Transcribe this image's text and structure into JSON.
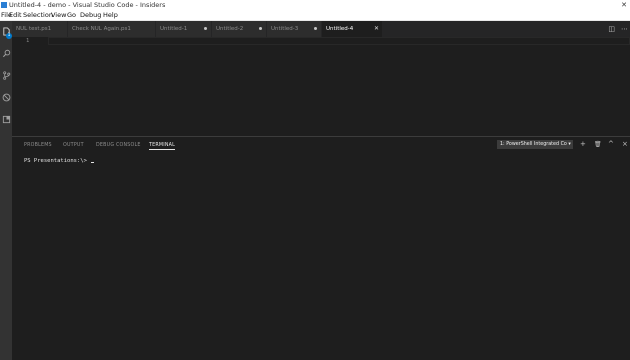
{
  "window": {
    "title": "Untitled-4 - demo - Visual Studio Code - Insiders"
  },
  "menubar": {
    "items": [
      "File",
      "Edit",
      "Selection",
      "View",
      "Go",
      "Debug",
      "Help"
    ]
  },
  "activitybar": {
    "icons": [
      "files-icon",
      "search-icon",
      "source-control-icon",
      "debug-icon",
      "extensions-icon"
    ],
    "badge": "1"
  },
  "tabs": [
    {
      "label": "NUL test.ps1",
      "dirty": false
    },
    {
      "label": "Check NUL Again.ps1",
      "dirty": false
    },
    {
      "label": "Untitled-1",
      "dirty": true
    },
    {
      "label": "Untitled-2",
      "dirty": true
    },
    {
      "label": "Untitled-3",
      "dirty": true
    },
    {
      "label": "Untitled-4",
      "active": true
    }
  ],
  "editor": {
    "line_number": "1"
  },
  "panel": {
    "tabs": [
      "PROBLEMS",
      "OUTPUT",
      "DEBUG CONSOLE",
      "TERMINAL"
    ],
    "active_tab": "TERMINAL",
    "terminal_selector": "1: PowerShell Integrated Co ▾",
    "actions": [
      "+",
      "🗑",
      "^",
      "×"
    ]
  },
  "terminal": {
    "prompt": "PS Presentations:\\> "
  },
  "colors": {
    "accent": "#007acc",
    "editor_bg": "#1e1e1e",
    "activity_bg": "#333333"
  }
}
